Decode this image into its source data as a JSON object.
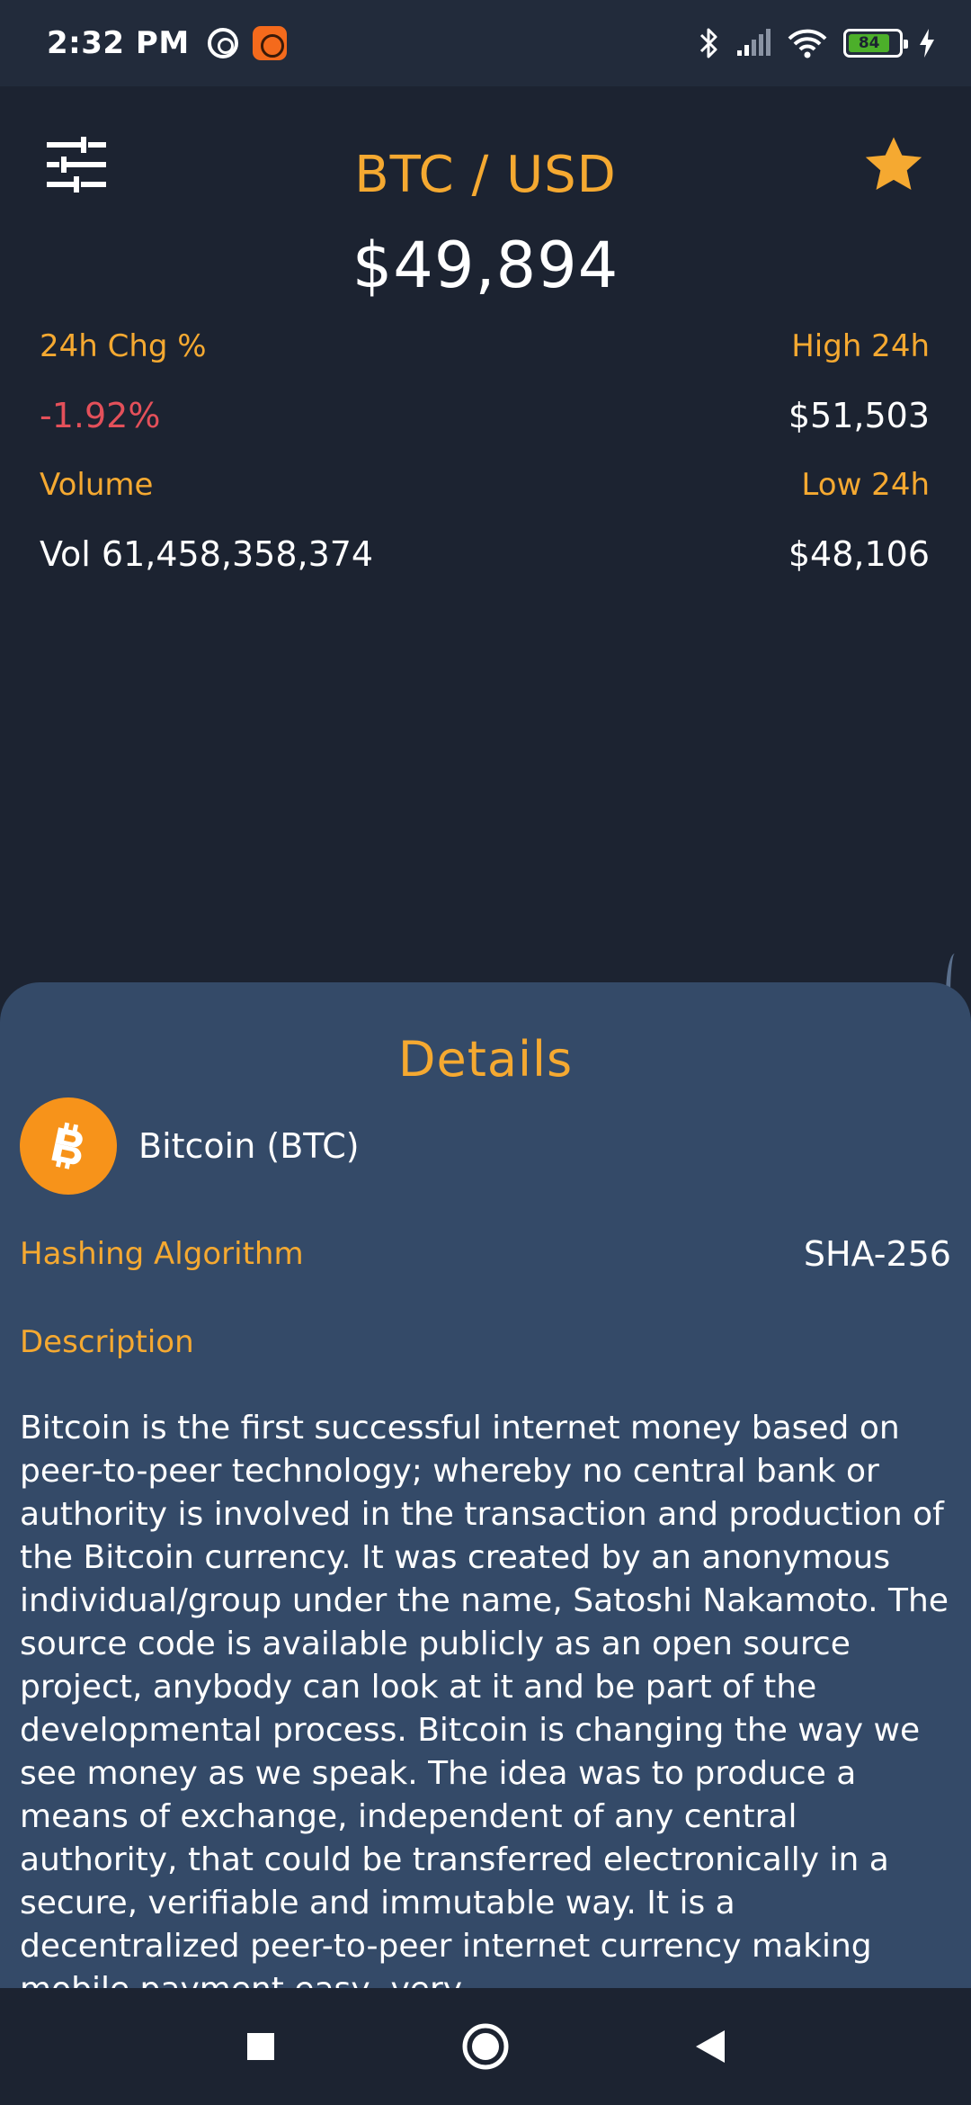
{
  "status_bar": {
    "time": "2:32 PM",
    "battery_level": "84",
    "icons": [
      "at-sign-icon",
      "app-notification-icon",
      "bluetooth-icon",
      "signal-icon",
      "wifi-icon",
      "battery-icon",
      "charging-icon"
    ]
  },
  "header": {
    "pair": "BTC / USD",
    "price": "$49,894",
    "accent_color": "#f5a931"
  },
  "stats": {
    "change_label": "24h Chg %",
    "change_value": "-1.92%",
    "high_label": "High 24h",
    "high_value": "$51,503",
    "volume_label": "Volume",
    "volume_value": "Vol 61,458,358,374",
    "low_label": "Low 24h",
    "low_value": "$48,106",
    "negative_color": "#e4505a"
  },
  "details": {
    "title": "Details",
    "coin_name": "Bitcoin (BTC)",
    "algo_label": "Hashing Algorithm",
    "algo_value": "SHA-256",
    "description_label": "Description",
    "description": "Bitcoin is the first successful internet money based on peer-to-peer technology; whereby no central bank or authority is involved in the transaction and production of the Bitcoin currency. It was created by an anonymous individual/group under the name, Satoshi Nakamoto. The source code is available publicly as an open source project, anybody can look at it and be part of the developmental process. Bitcoin is changing the way we see money as we speak. The idea was to produce a means of exchange, independent of any central authority, that could be transferred electronically in a secure, verifiable and immutable way. It is a decentralized peer-to-peer internet currency making mobile payment easy, very"
  },
  "nav": {
    "icons": [
      "recents-icon",
      "home-icon",
      "back-icon"
    ]
  }
}
